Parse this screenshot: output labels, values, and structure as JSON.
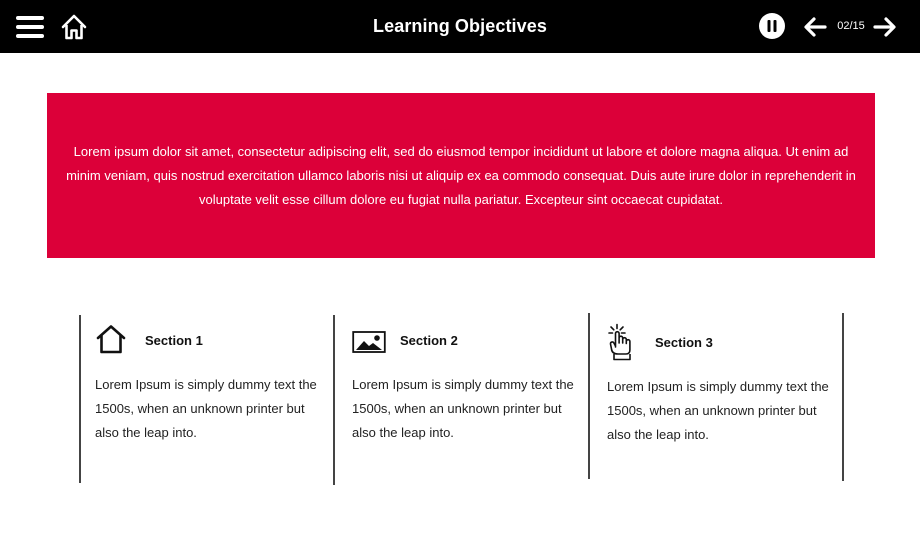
{
  "header": {
    "menu_icon": "hamburger-menu-icon",
    "home_icon": "home-icon",
    "title": "Learning Objectives",
    "pause_icon": "pause-icon",
    "prev_icon": "arrow-left-icon",
    "page_counter": "02/15",
    "next_icon": "arrow-right-icon",
    "background_color": "#000000"
  },
  "banner": {
    "text": "Lorem ipsum dolor sit amet, consectetur adipiscing elit, sed do eiusmod tempor incididunt ut labore et dolore magna aliqua. Ut enim ad minim veniam, quis nostrud exercitation ullamco laboris nisi ut aliquip ex ea commodo consequat. Duis aute irure dolor in reprehenderit in voluptate velit esse cillum dolore eu fugiat nulla pariatur. Excepteur sint occaecat cupidatat.",
    "background_color": "#dc0039"
  },
  "sections": [
    {
      "icon": "house-outline-icon",
      "title": "Section 1",
      "body": "Lorem Ipsum is simply dummy text the 1500s, when an unknown printer but also the leap into."
    },
    {
      "icon": "image-landscape-icon",
      "title": "Section 2",
      "body": "Lorem Ipsum is simply dummy text the 1500s, when an unknown printer but also the leap into."
    },
    {
      "icon": "hand-tap-icon",
      "title": "Section 3",
      "body": "Lorem Ipsum is simply dummy text the 1500s, when an unknown printer but also the leap into."
    }
  ]
}
